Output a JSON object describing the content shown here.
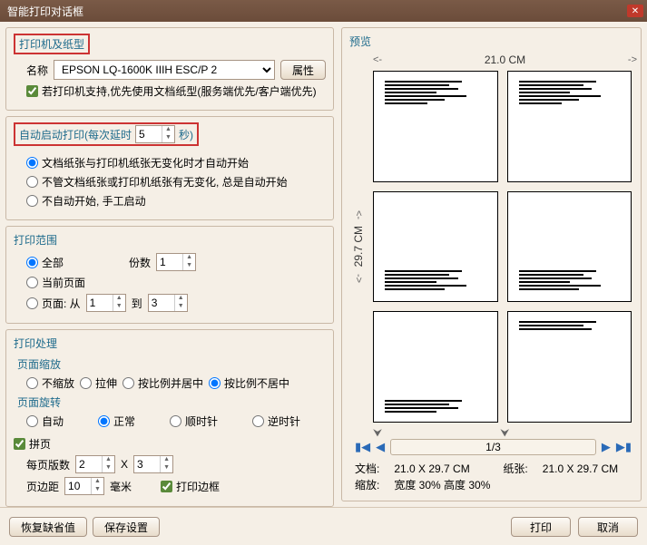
{
  "title": "智能打印对话框",
  "printer": {
    "group_title": "打印机及纸型",
    "name_label": "名称",
    "selected": "EPSON LQ-1600K IIIH ESC/P 2",
    "props_btn": "属性",
    "prefer_doc_label": "若打印机支持,优先使用文档纸型(服务端优先/客户端优先)"
  },
  "autostart": {
    "prefix": "自动启动打印(每次延时",
    "value": "5",
    "suffix": "秒)",
    "opt1": "文档纸张与打印机纸张无变化时才自动开始",
    "opt2": "不管文档纸张或打印机纸张有无变化, 总是自动开始",
    "opt3": "不自动开始, 手工启动"
  },
  "range": {
    "title": "打印范围",
    "all": "全部",
    "copies_label": "份数",
    "copies": "1",
    "current": "当前页面",
    "pages": "页面:  从",
    "from": "1",
    "to_label": "到",
    "to": "3"
  },
  "process": {
    "title": "打印处理",
    "zoom_title": "页面缩放",
    "z1": "不缩放",
    "z2": "拉伸",
    "z3": "按比例并居中",
    "z4": "按比例不居中",
    "rotate_title": "页面旋转",
    "r1": "自动",
    "r2": "正常",
    "r3": "顺时针",
    "r4": "逆时针",
    "collate": "拼页",
    "per_page_label": "每页版数",
    "per_page": "2",
    "x_label": "X",
    "per_page2": "3",
    "margin_label": "页边距",
    "margin": "10",
    "margin_unit": "毫米",
    "print_border": "打印边框"
  },
  "preview": {
    "title": "预览",
    "width": "21.0 CM",
    "height": "29.7 CM",
    "page": "1/3",
    "doc_label": "文档:",
    "doc_val": "21.0 X 29.7 CM",
    "paper_label": "纸张:",
    "paper_val": "21.0 X 29.7 CM",
    "scale_label": "缩放:",
    "scale_val": "宽度 30%  高度 30%"
  },
  "footer": {
    "restore": "恢复缺省值",
    "save": "保存设置",
    "print": "打印",
    "cancel": "取消"
  }
}
